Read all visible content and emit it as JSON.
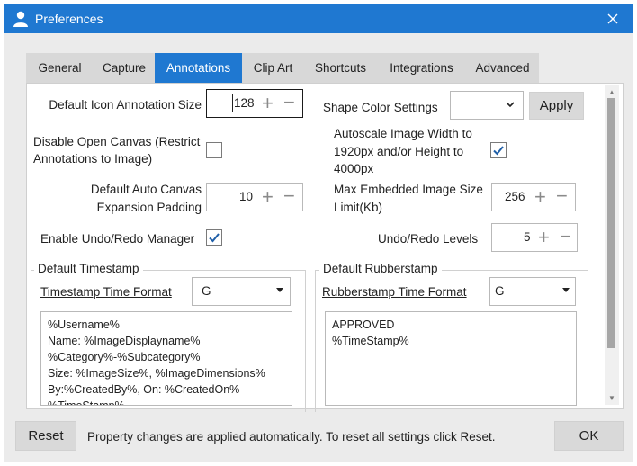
{
  "window": {
    "title": "Preferences"
  },
  "tabs": [
    {
      "label": "General",
      "active": false
    },
    {
      "label": "Capture",
      "active": false
    },
    {
      "label": "Annotations",
      "active": true
    },
    {
      "label": "Clip Art",
      "active": false
    },
    {
      "label": "Shortcuts",
      "active": false
    },
    {
      "label": "Integrations",
      "active": false
    },
    {
      "label": "Advanced",
      "active": false
    }
  ],
  "settings": {
    "icon_size": {
      "label": "Default Icon Annotation Size",
      "value": "128"
    },
    "shape_color": {
      "label": "Shape Color Settings",
      "value": "",
      "apply_label": "Apply"
    },
    "disable_canvas": {
      "label_line1": "Disable Open Canvas (Restrict",
      "label_line2": "Annotations to Image)",
      "checked": false
    },
    "autoscale": {
      "label_line1": "Autoscale Image Width to",
      "label_line2": "1920px and/or Height to",
      "label_line3": "4000px",
      "checked": true
    },
    "auto_padding": {
      "label_line1": "Default Auto Canvas",
      "label_line2": "Expansion Padding",
      "value": "10"
    },
    "max_embedded": {
      "label_line1": "Max Embedded Image Size",
      "label_line2": "Limit(Kb)",
      "value": "256"
    },
    "undo_manager": {
      "label": "Enable Undo/Redo Manager",
      "checked": true
    },
    "undo_levels": {
      "label": "Undo/Redo Levels",
      "value": "5"
    }
  },
  "timestamp": {
    "group_title": "Default Timestamp",
    "format_label": "Timestamp Time Format",
    "format_value": "G",
    "lines": [
      "%Username%",
      "Name: %ImageDisplayname%",
      "%Category%-%Subcategory%",
      "Size: %ImageSize%, %ImageDimensions%",
      "By:%CreatedBy%, On: %CreatedOn%",
      "%TimeStamp%"
    ]
  },
  "rubberstamp": {
    "group_title": "Default Rubberstamp",
    "format_label": "Rubberstamp Time Format",
    "format_value": "G",
    "lines": [
      "APPROVED",
      "%TimeStamp%"
    ]
  },
  "footer": {
    "reset_label": "Reset",
    "message": "Property changes are applied automatically. To reset all settings click Reset.",
    "ok_label": "OK"
  },
  "icons": {
    "app": "user-icon",
    "close": "close-icon",
    "plus": "plus-icon",
    "minus": "minus-icon",
    "dropdown": "chevron-down-icon",
    "check": "checkmark-icon"
  },
  "colors": {
    "accent": "#1f78d1",
    "window_bg": "#ebebeb",
    "button_bg": "#d9d9d9"
  }
}
